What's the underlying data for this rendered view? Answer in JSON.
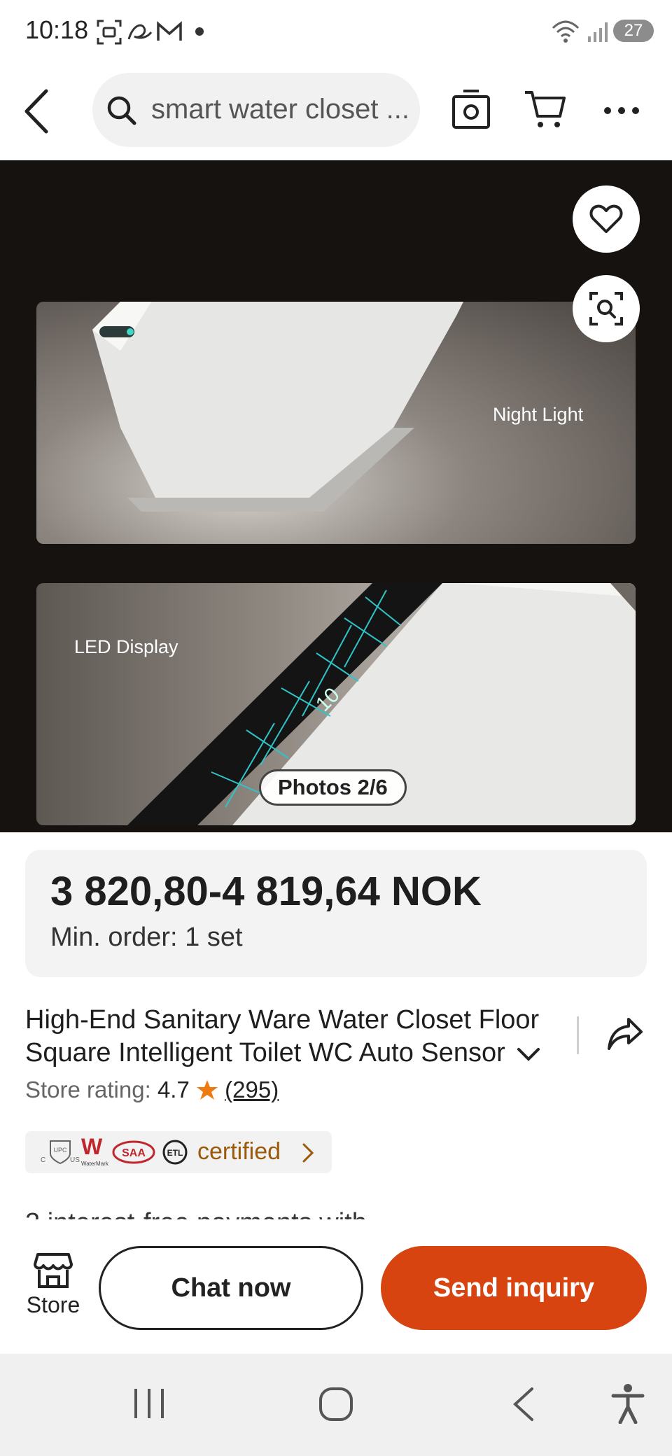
{
  "status_bar": {
    "time": "10:18",
    "battery": "27"
  },
  "header": {
    "search_text": "smart water closet ..."
  },
  "gallery": {
    "label_night_light": "Night Light",
    "label_led_display": "LED Display",
    "photos_counter": "Photos 2/6",
    "panel_display_text": "10"
  },
  "price": {
    "range": "3 820,80-4 819,64 NOK",
    "min_order": "Min. order: 1 set"
  },
  "product": {
    "title": "High-End Sanitary Ware Water Closet Floor Square Intelligent Toilet WC Auto Sensor",
    "rating_label": "Store rating:",
    "rating_value": "4.7",
    "rating_count": "(295)"
  },
  "certifications": {
    "label": "certified",
    "logos": [
      "UPC",
      "W",
      "SAA",
      "ETL"
    ],
    "logo_subtexts": [
      "C",
      "US",
      "WaterMark"
    ]
  },
  "truncated_text": "3 interest-free payments with",
  "actions": {
    "store_label": "Store",
    "chat_label": "Chat now",
    "inquiry_label": "Send inquiry"
  },
  "colors": {
    "accent": "#d84410",
    "certified_text": "#9b5a0a",
    "rating_star": "#f07a12"
  },
  "icons": {
    "back": "back-arrow-icon",
    "search": "search-icon",
    "camera": "camera-icon",
    "cart": "cart-icon",
    "more": "more-icon",
    "favorite": "heart-icon",
    "visual_search": "image-search-icon",
    "share": "share-icon",
    "store": "store-icon"
  }
}
